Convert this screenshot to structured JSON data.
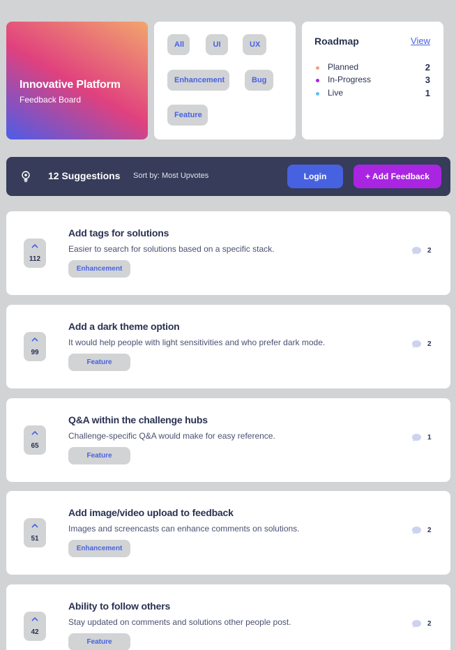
{
  "brand": {
    "title": "Innovative Platform",
    "subtitle": "Feedback Board"
  },
  "filters": [
    "All",
    "UI",
    "UX",
    "Enhancement",
    "Bug",
    "Feature"
  ],
  "roadmap": {
    "title": "Roadmap",
    "view_label": "View",
    "items": [
      {
        "label": "Planned",
        "count": "2",
        "color": "#f49f85"
      },
      {
        "label": "In-Progress",
        "count": "3",
        "color": "#ad1fea"
      },
      {
        "label": "Live",
        "count": "1",
        "color": "#62bcfa"
      }
    ]
  },
  "toolbar": {
    "icon": "lightbulb-icon",
    "suggestions": "12 Suggestions",
    "sort": "Sort by: Most Upvotes",
    "login_label": "Login",
    "add_label": "+ Add Feedback"
  },
  "suggestions": [
    {
      "upvotes": "112",
      "title": "Add tags for solutions",
      "description": "Easier to search for solutions based on a specific stack.",
      "tag": "Enhancement",
      "comments": "2"
    },
    {
      "upvotes": "99",
      "title": "Add a dark theme option",
      "description": "It would help people with light sensitivities and who prefer dark mode.",
      "tag": "Feature",
      "comments": "2"
    },
    {
      "upvotes": "65",
      "title": "Q&A within the challenge hubs",
      "description": "Challenge-specific Q&A would make for easy reference.",
      "tag": "Feature",
      "comments": "1"
    },
    {
      "upvotes": "51",
      "title": "Add image/video upload to feedback",
      "description": "Images and screencasts can enhance comments on solutions.",
      "tag": "Enhancement",
      "comments": "2"
    },
    {
      "upvotes": "42",
      "title": "Ability to follow others",
      "description": "Stay updated on comments and solutions other people post.",
      "tag": "Feature",
      "comments": "2"
    }
  ]
}
